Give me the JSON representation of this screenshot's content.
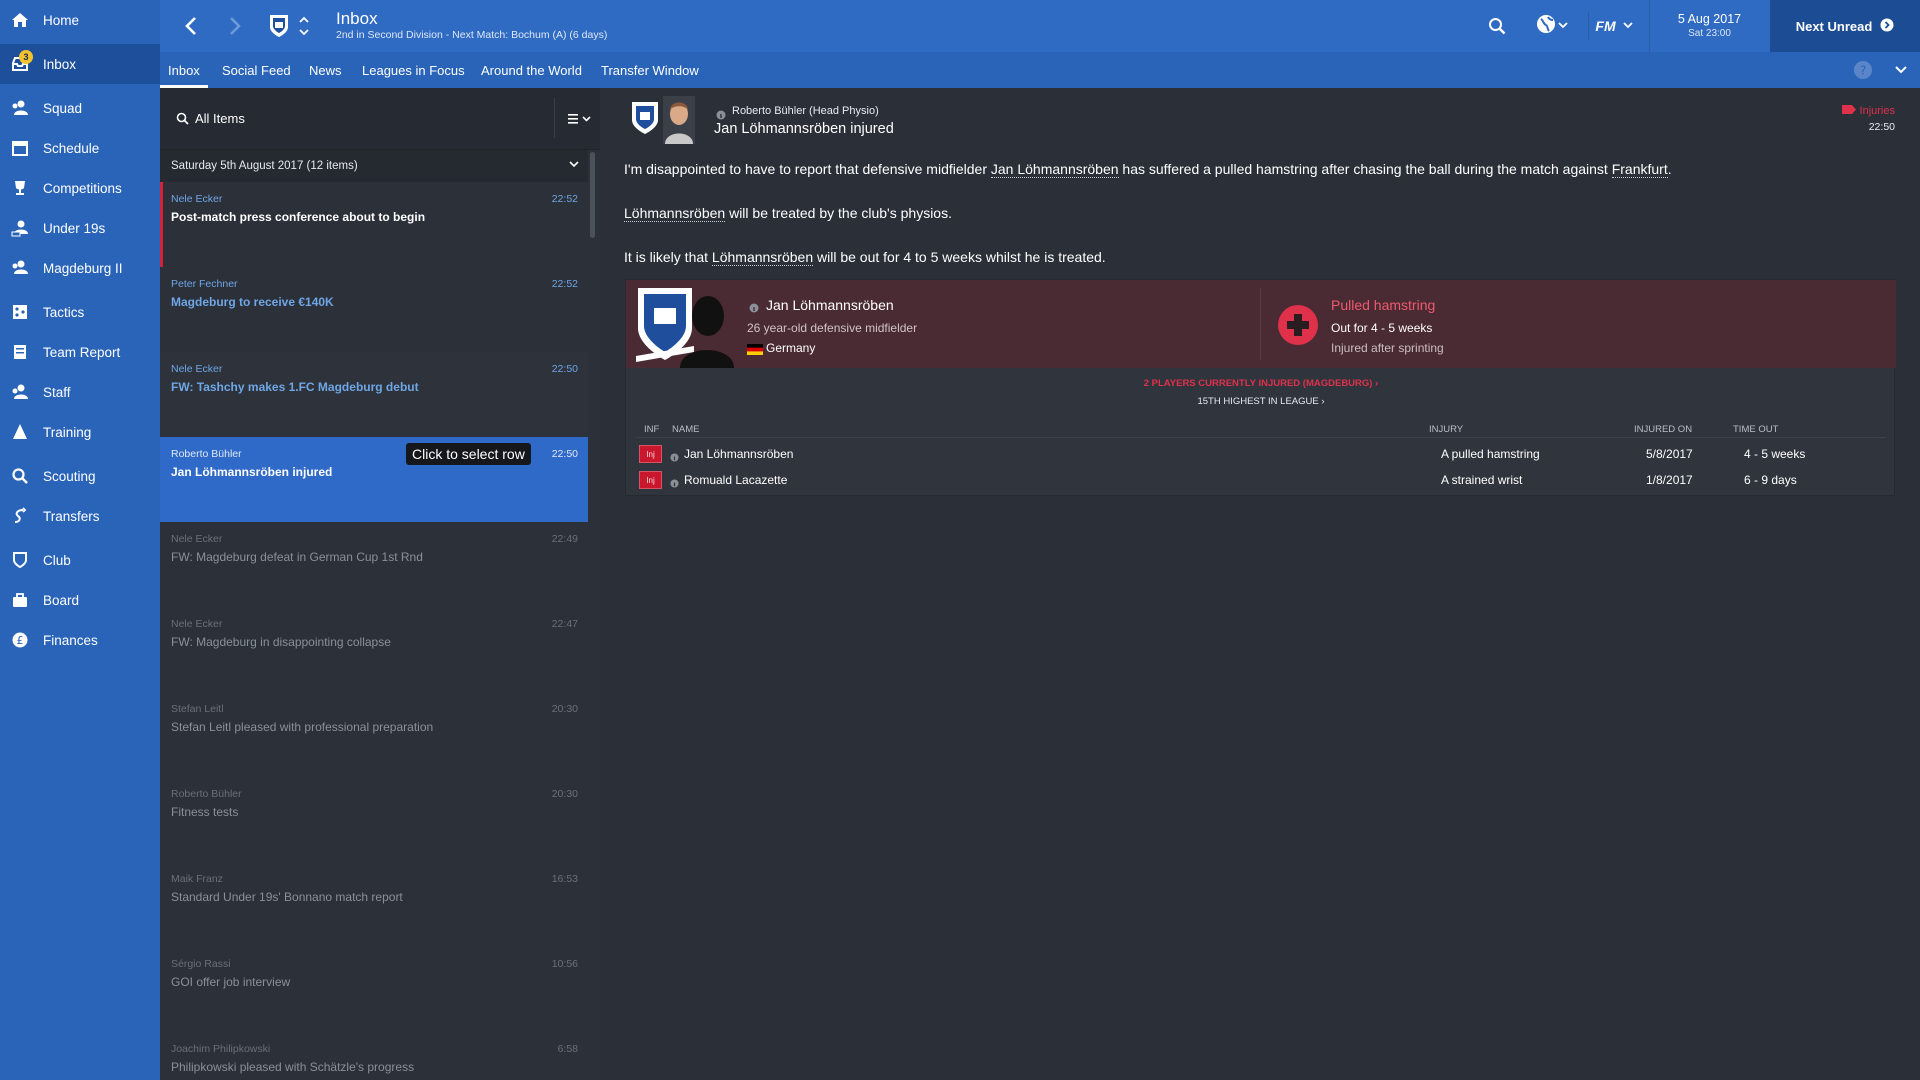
{
  "sidebar": {
    "items": [
      {
        "label": "Home",
        "icon": "home-icon"
      },
      {
        "label": "Inbox",
        "icon": "inbox-icon",
        "badge": "3"
      },
      {
        "label": "Squad",
        "icon": "squad-icon"
      },
      {
        "label": "Schedule",
        "icon": "calendar-icon"
      },
      {
        "label": "Competitions",
        "icon": "trophy-icon"
      },
      {
        "label": "Under 19s",
        "icon": "youth-team-icon"
      },
      {
        "label": "Magdeburg II",
        "icon": "reserve-team-icon"
      },
      {
        "label": "Tactics",
        "icon": "tactics-icon"
      },
      {
        "label": "Team Report",
        "icon": "report-icon"
      },
      {
        "label": "Staff",
        "icon": "staff-icon"
      },
      {
        "label": "Training",
        "icon": "training-icon"
      },
      {
        "label": "Scouting",
        "icon": "scouting-icon"
      },
      {
        "label": "Transfers",
        "icon": "transfers-icon"
      },
      {
        "label": "Club",
        "icon": "club-icon"
      },
      {
        "label": "Board",
        "icon": "board-icon"
      },
      {
        "label": "Finances",
        "icon": "finances-icon"
      }
    ]
  },
  "header": {
    "title": "Inbox",
    "subtitle": "2nd in Second Division - Next Match: Bochum (A) (6 days)",
    "date": "5 Aug 2017",
    "day_time": "Sat 23:00",
    "next_unread": "Next Unread",
    "logo_text": "FM"
  },
  "tabs": [
    "Inbox",
    "Social Feed",
    "News",
    "Leagues in Focus",
    "Around the World",
    "Transfer Window"
  ],
  "list": {
    "filter_label": "All Items",
    "group_header": "Saturday 5th August 2017 (12 items)",
    "tooltip": "Click to select row",
    "messages": [
      {
        "sender": "Nele Ecker",
        "time": "22:52",
        "subject": "Post-match press conference about to begin"
      },
      {
        "sender": "Peter Fechner",
        "time": "22:52",
        "subject": "Magdeburg to receive €140K"
      },
      {
        "sender": "Nele Ecker",
        "time": "22:50",
        "subject": "FW: Tashchy makes 1.FC Magdeburg debut"
      },
      {
        "sender": "Roberto Bühler",
        "time": "22:50",
        "subject": "Jan Löhmannsröben injured"
      },
      {
        "sender": "Nele Ecker",
        "time": "22:49",
        "subject": "FW: Magdeburg defeat in German Cup 1st Rnd"
      },
      {
        "sender": "Nele Ecker",
        "time": "22:47",
        "subject": "FW: Magdeburg in disappointing collapse"
      },
      {
        "sender": "Stefan Leitl",
        "time": "20:30",
        "subject": "Stefan Leitl pleased with professional preparation"
      },
      {
        "sender": "Roberto Bühler",
        "time": "20:30",
        "subject": "Fitness tests"
      },
      {
        "sender": "Maik Franz",
        "time": "16:53",
        "subject": "Standard Under 19s' Bonnano match report"
      },
      {
        "sender": "Sérgio Rassi",
        "time": "10:56",
        "subject": "GOI offer job interview"
      },
      {
        "sender": "Joachim Philipkowski",
        "time": "6:58",
        "subject": "Philipkowski pleased with Schätzle's progress"
      }
    ]
  },
  "detail": {
    "sender": "Roberto Bühler  (Head Physio)",
    "title": "Jan Löhmannsröben injured",
    "tag": "Injuries",
    "time": "22:50",
    "p1_a": "I'm disappointed to have to report that defensive midfielder ",
    "p1_name": "Jan Löhmannsröben",
    "p1_b": " has suffered a pulled hamstring after chasing the ball during the match against ",
    "p1_club": "Frankfurt",
    "p1_c": ".",
    "p2_name": "Löhmannsröben",
    "p2_b": " will be treated by the club's physios.",
    "p3_a": "It is likely that ",
    "p3_name": "Löhmannsröben",
    "p3_b": " will be out for 4 to 5 weeks whilst he is treated.",
    "card": {
      "player_name": "Jan Löhmannsröben",
      "player_desc": "26 year-old defensive midfielder",
      "nationality": "Germany",
      "injury_title": "Pulled hamstring",
      "injury_out": "Out for 4 - 5 weeks",
      "injury_cause": "Injured after sprinting",
      "summary_link": "2 PLAYERS CURRENTLY INJURED (MAGDEBURG)",
      "summary_sub": "15TH HIGHEST IN LEAGUE",
      "headers": {
        "inf": "INF",
        "name": "NAME",
        "injury": "INJURY",
        "injured_on": "INJURED ON",
        "time_out": "TIME OUT"
      },
      "rows": [
        {
          "inf": "Inj",
          "name": "Jan Löhmannsröben",
          "injury": "A pulled hamstring",
          "injured_on": "5/8/2017",
          "time_out": "4 - 5 weeks"
        },
        {
          "inf": "Inj",
          "name": "Romuald Lacazette",
          "injury": "A strained wrist",
          "injured_on": "1/8/2017",
          "time_out": "6 - 9 days"
        }
      ]
    }
  },
  "colors": {
    "accent": "#2f6bc2",
    "sidebar": "#2a64b8",
    "injury": "#e0314b",
    "selected": "#2f6ac8"
  }
}
